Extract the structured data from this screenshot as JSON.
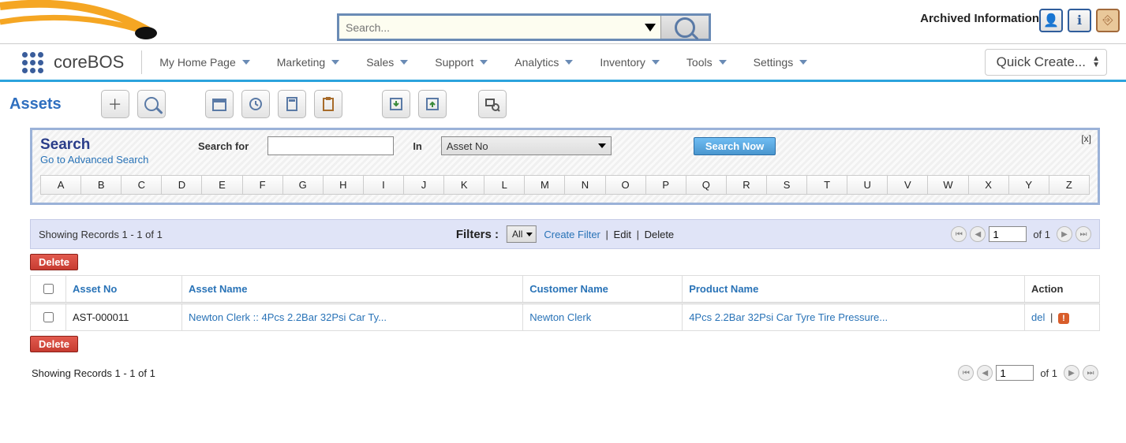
{
  "top": {
    "brand": "coreBOS",
    "archived": "Archived Information",
    "search_placeholder": "Search..."
  },
  "nav": {
    "items": [
      {
        "label": "My Home Page"
      },
      {
        "label": "Marketing"
      },
      {
        "label": "Sales"
      },
      {
        "label": "Support"
      },
      {
        "label": "Analytics"
      },
      {
        "label": "Inventory"
      },
      {
        "label": "Tools"
      },
      {
        "label": "Settings"
      }
    ],
    "quick_create": "Quick Create..."
  },
  "module": {
    "title": "Assets"
  },
  "search_panel": {
    "title": "Search",
    "advanced": "Go to Advanced Search",
    "search_for_label": "Search for",
    "search_for_value": "",
    "in_label": "In",
    "in_value": "Asset No",
    "button": "Search Now",
    "close": "[x]",
    "alpha": [
      "A",
      "B",
      "C",
      "D",
      "E",
      "F",
      "G",
      "H",
      "I",
      "J",
      "K",
      "L",
      "M",
      "N",
      "O",
      "P",
      "Q",
      "R",
      "S",
      "T",
      "U",
      "V",
      "W",
      "X",
      "Y",
      "Z"
    ]
  },
  "filterbar": {
    "showing": "Showing Records 1 - 1 of 1",
    "filters_label": "Filters :",
    "filter_value": "All",
    "create_filter": "Create Filter",
    "edit": "Edit",
    "delete": "Delete",
    "page": "1",
    "of": "of 1"
  },
  "table": {
    "delete_btn": "Delete",
    "headers": {
      "asset_no": "Asset No",
      "asset_name": "Asset Name",
      "customer_name": "Customer Name",
      "product_name": "Product Name",
      "action": "Action"
    },
    "rows": [
      {
        "asset_no": "AST-000011",
        "asset_name": "Newton Clerk :: 4Pcs 2.2Bar 32Psi Car Ty...",
        "customer_name": "Newton Clerk",
        "product_name": "4Pcs 2.2Bar 32Psi Car Tyre Tire Pressure...",
        "del": "del"
      }
    ]
  },
  "bottom": {
    "showing": "Showing Records 1 - 1 of 1",
    "page": "1",
    "of": "of 1"
  }
}
